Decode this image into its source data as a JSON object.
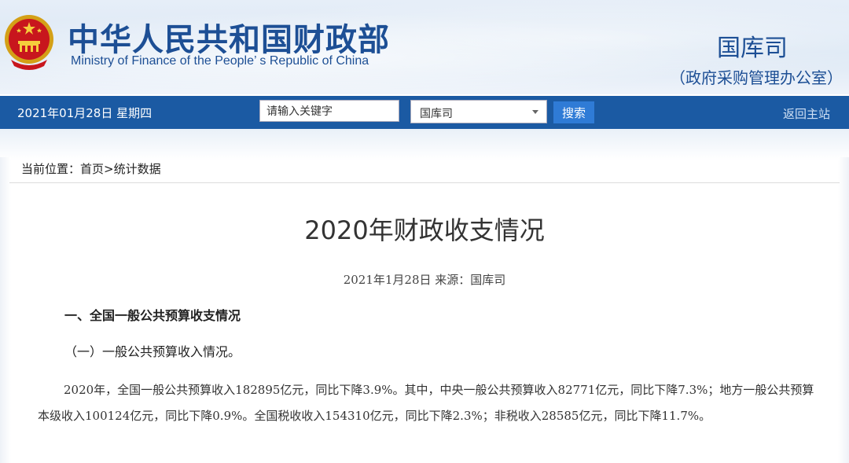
{
  "header": {
    "site_name_cn": "中华人民共和国财政部",
    "site_name_en": "Ministry of Finance of the People’ s Republic of China",
    "department": "国库司",
    "department_sub": "（政府采购管理办公室）"
  },
  "navbar": {
    "date": "2021年01月28日  星期四",
    "search_value": "请输入关键字",
    "select_value": "国库司",
    "search_button": "搜索",
    "return_link": "返回主站"
  },
  "breadcrumb": {
    "prefix": "当前位置：",
    "home": "首页",
    "separator": ">",
    "current": "统计数据"
  },
  "article": {
    "title": "2020年财政收支情况",
    "meta": "2021年1月28日  来源：国库司",
    "section1": "一、全国一般公共预算收支情况",
    "subsection1": "（一）一般公共预算收入情况。",
    "paragraph1": "2020年，全国一般公共预算收入182895亿元，同比下降3.9%。其中，中央一般公共预算收入82771亿元，同比下降7.3%；地方一般公共预算本级收入100124亿元，同比下降0.9%。全国税收收入154310亿元，同比下降2.3%；非税收入28585亿元，同比下降11.7%。"
  },
  "colors": {
    "brand_blue": "#1d4f95",
    "nav_bar": "#1b5aa3",
    "button": "#2f7bd6"
  }
}
